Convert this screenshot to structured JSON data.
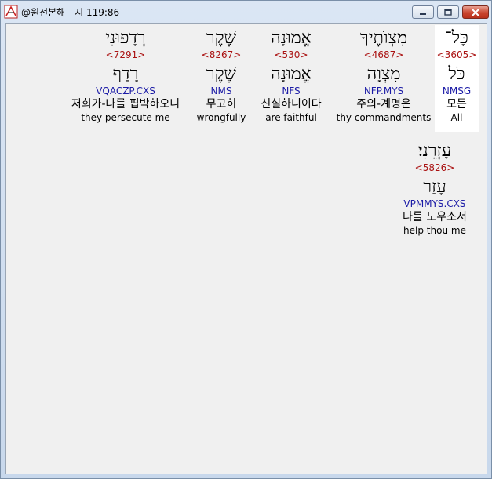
{
  "window": {
    "title": "@원전본해 - 시 119:86"
  },
  "words": [
    {
      "surface": "כָּל־",
      "strong": "<3605>",
      "lemma": "כֹּל",
      "morph": "NMSG",
      "korean": "모든",
      "english": "All",
      "selected": true
    },
    {
      "surface": "מִצְוֺתֶיךָ",
      "strong": "<4687>",
      "lemma": "מִצְוָה",
      "morph": "NFP.MYS",
      "korean": "주의-계명은",
      "english": "thy commandments"
    },
    {
      "surface": "אֱמוּנָה",
      "strong": "<530>",
      "lemma": "אֱמוּנָה",
      "morph": "NFS",
      "korean": "신실하니이다",
      "english": "are faithful"
    },
    {
      "surface": "שֶׁקֶר",
      "strong": "<8267>",
      "lemma": "שֶׁקֶר",
      "morph": "NMS",
      "korean": "무고히",
      "english": "wrongfully"
    },
    {
      "surface": "רְדָפוּנִי",
      "strong": "<7291>",
      "lemma": "רָדַף",
      "morph": "VQACZP.CXS",
      "korean": "저희가-나를 핍박하오니",
      "english": "they persecute me"
    },
    {
      "surface": "עָזְרֵנִי׃",
      "strong": "<5826>",
      "lemma": "עָזַר",
      "morph": "VPMMYS.CXS",
      "korean": "나를 도우소서",
      "english": "help thou me"
    }
  ],
  "colors": {
    "strong": "#aa1111",
    "morph": "#1a1aa6",
    "selection_bg": "#ffffff",
    "client_bg": "#f0f0f0"
  },
  "icons": {
    "app": "bible-app-icon",
    "minimize": "minimize-icon",
    "maximize": "maximize-icon",
    "close": "close-icon"
  }
}
